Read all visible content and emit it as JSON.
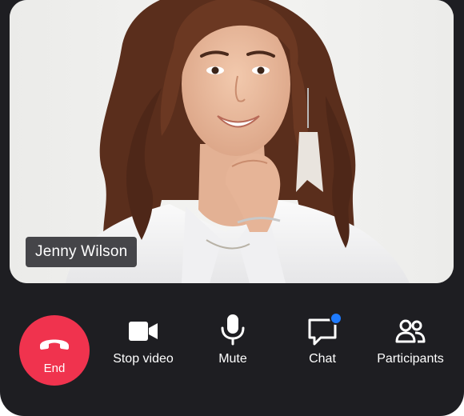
{
  "participant": {
    "name": "Jenny Wilson"
  },
  "controls": {
    "end": {
      "label": "End",
      "icon": "phone-hangup-icon",
      "color": "#f0334e"
    },
    "stop_video": {
      "label": "Stop video",
      "icon": "video-camera-icon"
    },
    "mute": {
      "label": "Mute",
      "icon": "microphone-icon"
    },
    "chat": {
      "label": "Chat",
      "icon": "chat-bubble-icon",
      "has_unread": true,
      "badge_color": "#1e7bff"
    },
    "participants": {
      "label": "Participants",
      "icon": "users-icon"
    }
  },
  "theme": {
    "background": "#1e1e22",
    "text": "#ffffff"
  }
}
